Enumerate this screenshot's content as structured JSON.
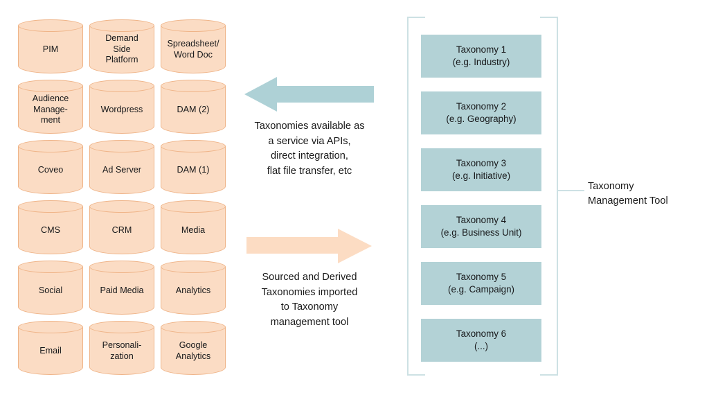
{
  "diagram": {
    "sources": {
      "columns": 3,
      "rows": 6,
      "items": [
        {
          "id": "pim",
          "label": "PIM"
        },
        {
          "id": "demand-side-platform",
          "label": "Demand\nSide\nPlatform"
        },
        {
          "id": "spreadsheet-word-doc",
          "label": "Spreadsheet/\nWord Doc"
        },
        {
          "id": "audience-management",
          "label": "Audience\nManage-\nment"
        },
        {
          "id": "wordpress",
          "label": "Wordpress"
        },
        {
          "id": "dam-2",
          "label": "DAM (2)"
        },
        {
          "id": "coveo",
          "label": "Coveo"
        },
        {
          "id": "ad-server",
          "label": "Ad Server"
        },
        {
          "id": "dam-1",
          "label": "DAM (1)"
        },
        {
          "id": "cms",
          "label": "CMS"
        },
        {
          "id": "crm",
          "label": "CRM"
        },
        {
          "id": "media",
          "label": "Media"
        },
        {
          "id": "social",
          "label": "Social"
        },
        {
          "id": "paid-media",
          "label": "Paid Media"
        },
        {
          "id": "analytics",
          "label": "Analytics"
        },
        {
          "id": "email",
          "label": "Email"
        },
        {
          "id": "personalization",
          "label": "Personali-\nzation"
        },
        {
          "id": "google-analytics",
          "label": "Google\nAnalytics"
        }
      ]
    },
    "flows": [
      {
        "id": "outbound",
        "direction": "left",
        "color": "#aed1d6",
        "caption": "Taxonomies available as\na service via APIs,\ndirect integration,\nflat file transfer, etc"
      },
      {
        "id": "inbound",
        "direction": "right",
        "color": "#fcdcc3",
        "caption": "Sourced and Derived\nTaxonomies imported\nto Taxonomy\nmanagement tool"
      }
    ],
    "taxonomy_panel": {
      "bracket_color": "#cde1e4",
      "box_color": "#b3d2d6",
      "callout_label": "Taxonomy\nManagement Tool",
      "items": [
        {
          "id": "taxonomy-1",
          "label": "Taxonomy 1\n(e.g. Industry)"
        },
        {
          "id": "taxonomy-2",
          "label": "Taxonomy 2\n(e.g. Geography)"
        },
        {
          "id": "taxonomy-3",
          "label": "Taxonomy 3\n(e.g. Initiative)"
        },
        {
          "id": "taxonomy-4",
          "label": "Taxonomy 4\n(e.g. Business Unit)"
        },
        {
          "id": "taxonomy-5",
          "label": "Taxonomy 5\n(e.g. Campaign)"
        },
        {
          "id": "taxonomy-6",
          "label": "Taxonomy 6\n(...)"
        }
      ]
    }
  }
}
